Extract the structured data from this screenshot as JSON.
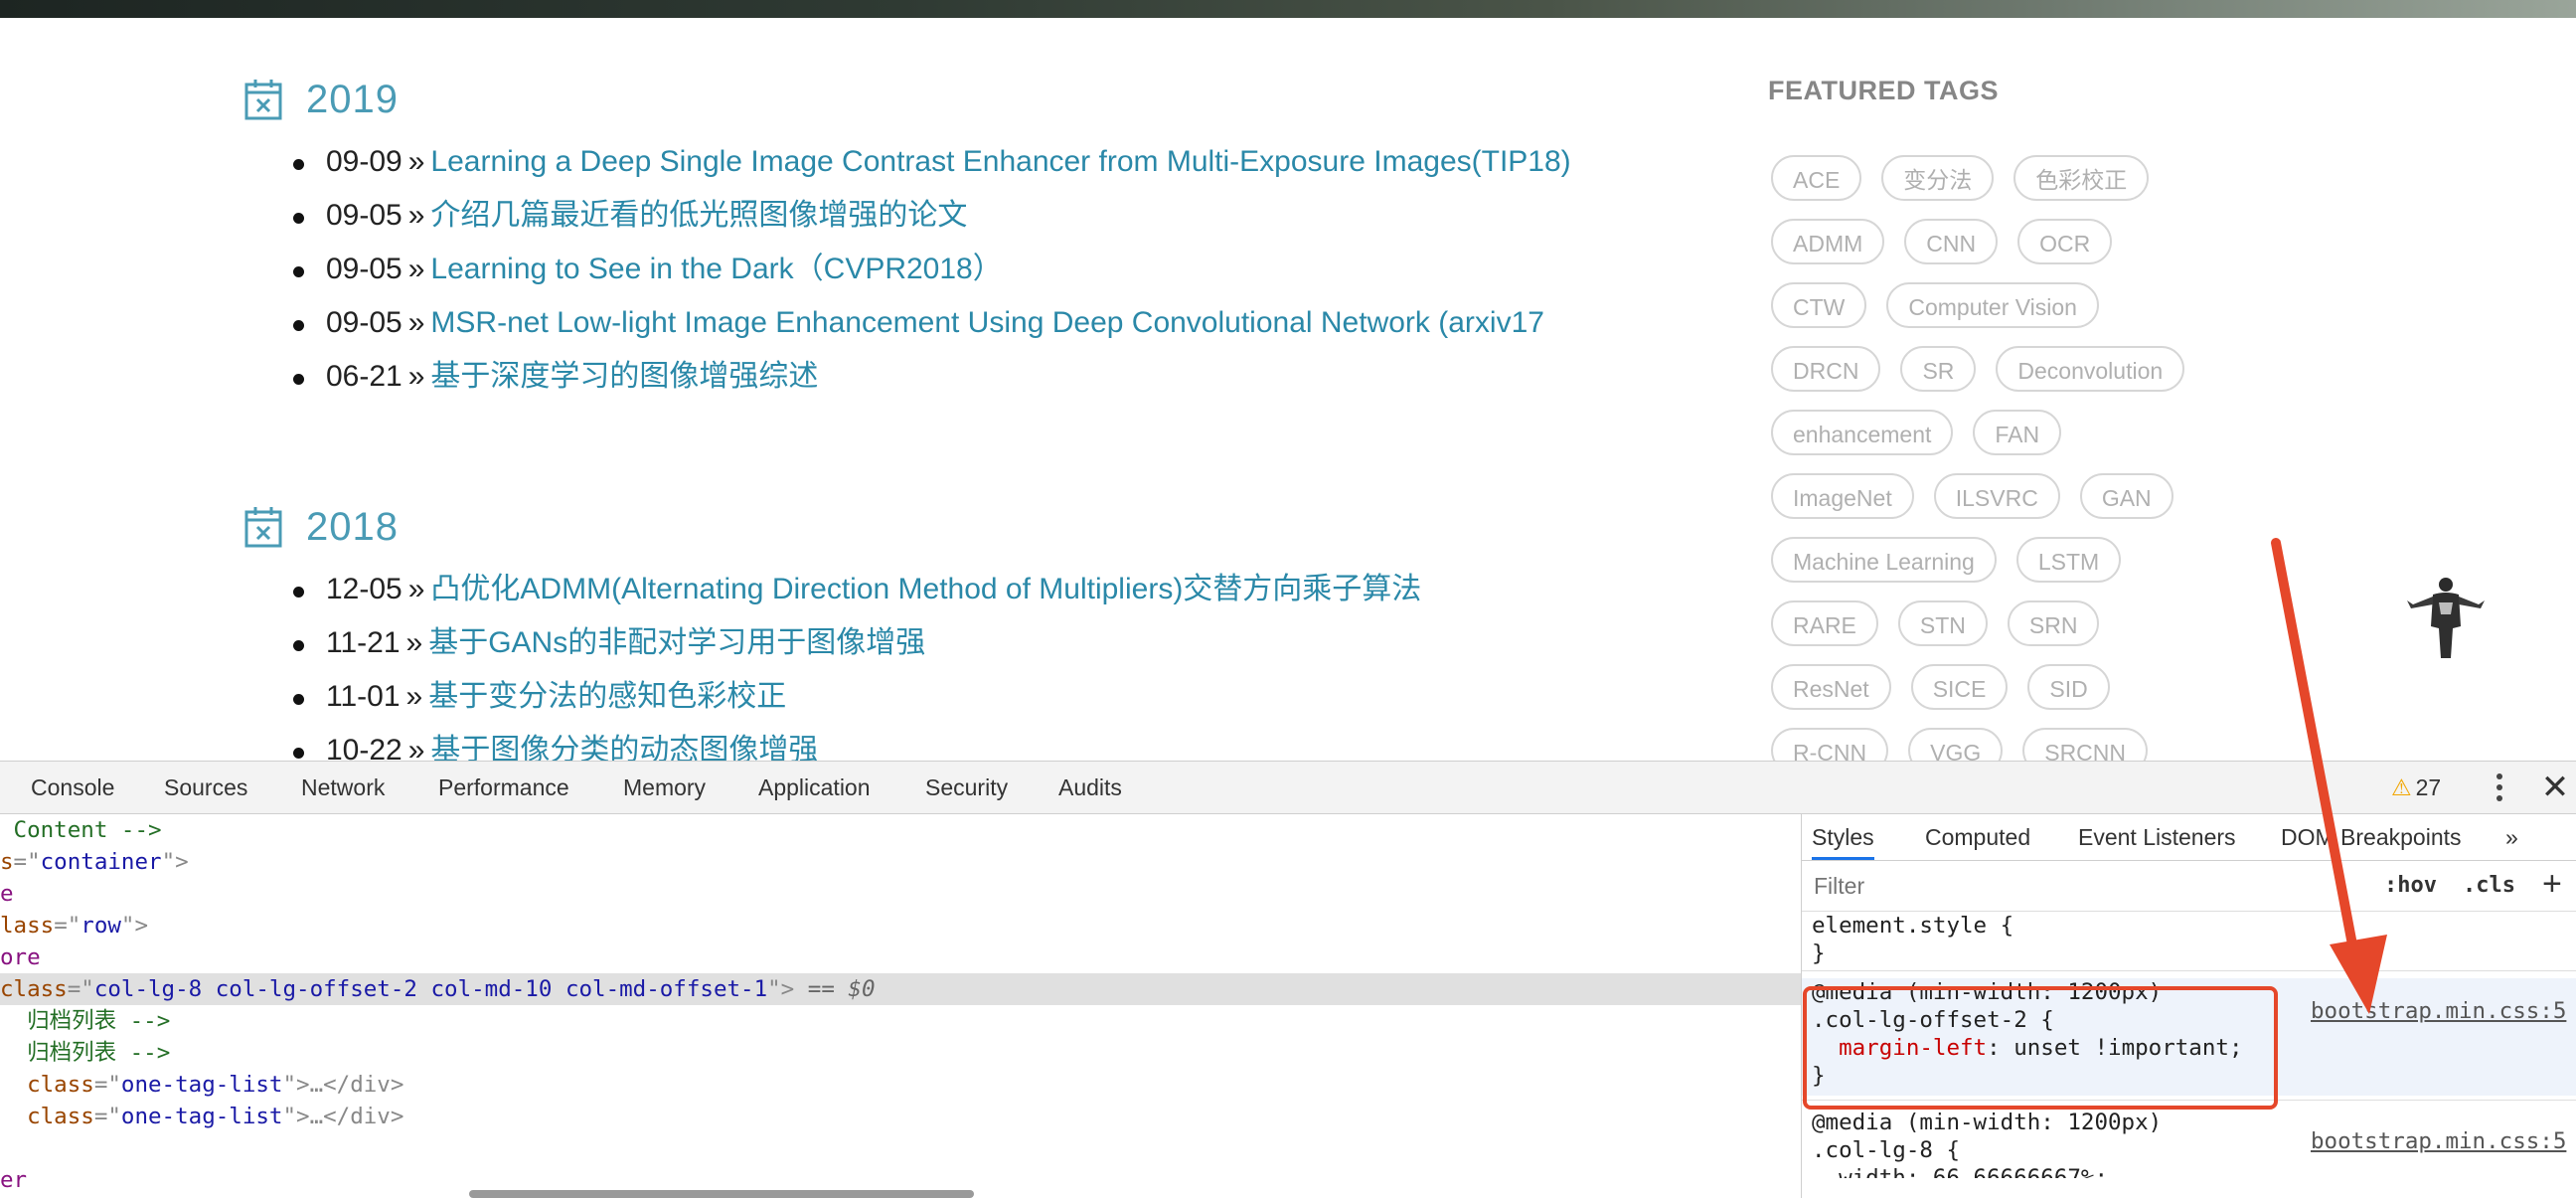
{
  "sections": [
    {
      "year": "2019",
      "posts": [
        {
          "date": "09-09",
          "title": "Learning a Deep Single Image Contrast Enhancer from Multi-Exposure Images(TIP18)"
        },
        {
          "date": "09-05",
          "title": "介绍几篇最近看的低光照图像增强的论文"
        },
        {
          "date": "09-05",
          "title": "Learning to See in the Dark（CVPR2018）"
        },
        {
          "date": "09-05",
          "title": "MSR-net Low-light Image Enhancement Using Deep Convolutional Network (arxiv17"
        },
        {
          "date": "06-21",
          "title": "基于深度学习的图像增强综述"
        }
      ]
    },
    {
      "year": "2018",
      "posts": [
        {
          "date": "12-05",
          "title": "凸优化ADMM(Alternating Direction Method of Multipliers)交替方向乘子算法"
        },
        {
          "date": "11-21",
          "title": "基于GANs的非配对学习用于图像增强"
        },
        {
          "date": "11-01",
          "title": "基于变分法的感知色彩校正"
        },
        {
          "date": "10-22",
          "title": "基于图像分类的动态图像增强"
        }
      ]
    }
  ],
  "separator": "»",
  "featured_tags": {
    "title": "FEATURED TAGS",
    "rows": [
      [
        "ACE",
        "变分法",
        "色彩校正"
      ],
      [
        "ADMM",
        "CNN",
        "OCR"
      ],
      [
        "CTW",
        "Computer Vision"
      ],
      [
        "DRCN",
        "SR",
        "Deconvolution"
      ],
      [
        "enhancement",
        "FAN"
      ],
      [
        "ImageNet",
        "ILSVRC",
        "GAN"
      ],
      [
        "Machine Learning",
        "LSTM"
      ],
      [
        "RARE",
        "STN",
        "SRN"
      ],
      [
        "ResNet",
        "SICE",
        "SID"
      ],
      [
        "R-CNN",
        "VGG",
        "SRCNN"
      ]
    ]
  },
  "devtools": {
    "tabs": [
      "Console",
      "Sources",
      "Network",
      "Performance",
      "Memory",
      "Application",
      "Security",
      "Audits"
    ],
    "warning_count": "27",
    "close_glyph": "✕",
    "dom_lines": [
      {
        "parts": [
          [
            "c-com",
            " Content -->"
          ]
        ]
      },
      {
        "parts": [
          [
            "c-attr",
            "s"
          ],
          [
            "c-gray",
            "=\""
          ],
          [
            "c-val",
            "container"
          ],
          [
            "c-gray",
            "\">"
          ]
        ]
      },
      {
        "parts": [
          [
            "c-tag",
            "e"
          ]
        ]
      },
      {
        "parts": [
          [
            "c-attr",
            "lass"
          ],
          [
            "c-gray",
            "=\""
          ],
          [
            "c-val",
            "row"
          ],
          [
            "c-gray",
            "\">"
          ]
        ]
      },
      {
        "parts": [
          [
            "c-tag",
            "ore"
          ]
        ]
      },
      {
        "selected": true,
        "parts": [
          [
            "c-attr",
            "class"
          ],
          [
            "c-gray",
            "=\""
          ],
          [
            "c-val",
            "col-lg-8 col-lg-offset-2 col-md-10 col-md-offset-1"
          ],
          [
            "c-gray",
            "\">"
          ],
          [
            "c-eq",
            " == $0"
          ]
        ]
      },
      {
        "parts": [
          [
            "c-com",
            "  归档列表 -->"
          ]
        ]
      },
      {
        "parts": [
          [
            "c-com",
            "  归档列表 -->"
          ]
        ]
      },
      {
        "parts": [
          [
            "c-attr",
            "  class"
          ],
          [
            "c-gray",
            "=\""
          ],
          [
            "c-val",
            "one-tag-list"
          ],
          [
            "c-gray",
            "\">…</div>"
          ]
        ]
      },
      {
        "parts": [
          [
            "c-attr",
            "  class"
          ],
          [
            "c-gray",
            "=\""
          ],
          [
            "c-val",
            "one-tag-list"
          ],
          [
            "c-gray",
            "\">…</div>"
          ]
        ]
      },
      {
        "parts": [
          [
            "c-tag",
            ""
          ]
        ]
      },
      {
        "parts": [
          [
            "c-tag",
            "er"
          ]
        ]
      }
    ],
    "styles_tabs": [
      "Styles",
      "Computed",
      "Event Listeners",
      "DOM Breakpoints"
    ],
    "styles_more": "»",
    "filter_placeholder": "Filter",
    "hov": ":hov",
    "cls": ".cls",
    "plus": "+",
    "element_style": [
      "element.style {",
      "}"
    ],
    "rule1": {
      "media": "@media (min-width: 1200px)",
      "selector": ".col-lg-offset-2 {",
      "prop": "margin-left",
      "value": ": unset !important;",
      "close": "}",
      "source": "bootstrap.min.css:5"
    },
    "rule2": {
      "media": "@media (min-width: 1200px)",
      "selector": ".col-lg-8 {",
      "partial": "  width: 66.66666667%;",
      "source": "bootstrap.min.css:5"
    }
  },
  "colors": {
    "accent": "#4a9bb5",
    "link": "#2a88a8",
    "annotation": "#e5472a"
  }
}
